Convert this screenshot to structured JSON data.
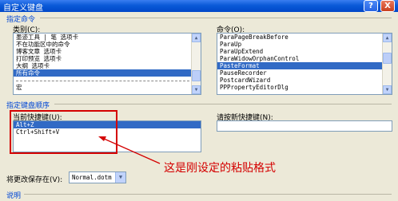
{
  "window": {
    "title": "自定义键盘",
    "help_label": "?",
    "close_label": "X"
  },
  "specify_command": {
    "section_label": "指定命令",
    "categories_label": "类别(C):",
    "categories": [
      "墨迹工具 | 笔 选项卡",
      "不在功能区中的命令",
      "博客文章 选项卡",
      "打印预览 选项卡",
      "大纲 选项卡",
      "所有命令",
      "",
      "宏"
    ],
    "categories_selected_index": 5,
    "commands_label": "命令(O):",
    "commands": [
      "ParaPageBreakBefore",
      "ParaUp",
      "ParaUpExtend",
      "ParaWidowOrphanControl",
      "PasteFormat",
      "PauseRecorder",
      "PostcardWizard",
      "PPPropertyEditorDlg"
    ],
    "commands_selected_index": 4
  },
  "keyboard_order": {
    "section_label": "指定键盘顺序",
    "current_keys_label": "当前快捷键(U):",
    "current_keys": [
      "Alt+Z",
      "Ctrl+Shift+V"
    ],
    "current_keys_selected_index": 0,
    "new_key_label": "请按新快捷键(N):",
    "new_key_value": ""
  },
  "save_changes": {
    "label": "将更改保存在(V):",
    "value": "Normal.dotm"
  },
  "description_label": "说明",
  "annotation": {
    "text": "这是刚设定的粘贴格式",
    "color": "#d40000"
  },
  "colors": {
    "title_bar": "#0a5ad8",
    "selection": "#316ac5",
    "section_text": "#0046d5",
    "dialog_bg": "#ece9d8"
  }
}
